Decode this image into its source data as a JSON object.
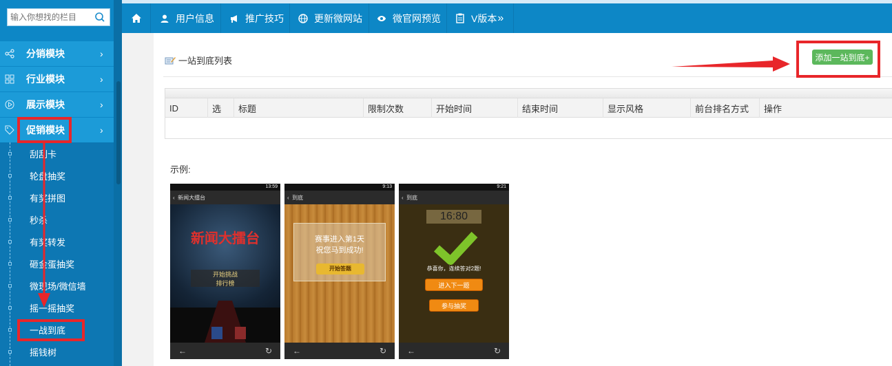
{
  "sidebar": {
    "search_placeholder": "输入你想找的栏目",
    "groups": [
      {
        "label": "分销模块",
        "icon": "share-icon"
      },
      {
        "label": "行业模块",
        "icon": "grid-icon"
      },
      {
        "label": "展示模块",
        "icon": "play-circle-icon"
      },
      {
        "label": "促销模块",
        "icon": "tag-icon"
      }
    ],
    "sub_items": [
      "刮刮卡",
      "轮盘抽奖",
      "有奖拼图",
      "秒杀",
      "有奖转发",
      "砸金蛋抽奖",
      "微现场/微信墙",
      "摇一摇抽奖",
      "一战到底",
      "摇钱树"
    ],
    "active_sub": "一战到底"
  },
  "topnav": {
    "items": [
      {
        "label": "",
        "icon": "home-icon"
      },
      {
        "label": "用户信息",
        "icon": "user-icon"
      },
      {
        "label": "推广技巧",
        "icon": "megaphone-icon"
      },
      {
        "label": "更新微网站",
        "icon": "globe-icon"
      },
      {
        "label": "微官网预览",
        "icon": "eye-icon"
      },
      {
        "label": "V版本",
        "icon": "clipboard-icon",
        "suffix": "»"
      }
    ]
  },
  "page": {
    "title": "一站到底列表",
    "add_button": "添加一站到底+",
    "table_headers": [
      "ID",
      "选",
      "标题",
      "限制次数",
      "开始时间",
      "结束时间",
      "显示风格",
      "前台排名方式",
      "操作"
    ],
    "example_label": "示例:"
  },
  "phones": [
    {
      "appbar": "新闻大擂台",
      "status_time": "13:59",
      "banner": "新闻大擂台",
      "buttons": [
        "开始挑战",
        "排行榜"
      ]
    },
    {
      "appbar": "到底",
      "status_time": "9:13",
      "card_lines": [
        "赛事进入第1天",
        "祝您马到成功!"
      ],
      "button": "开始答题"
    },
    {
      "appbar": "到底",
      "status_time": "9:21",
      "timer": "16:80",
      "message": "恭喜你，连续答对2题!",
      "buttons": [
        "进入下一题",
        "参与抽奖"
      ]
    }
  ],
  "colors": {
    "primary": "#0d87c6",
    "accent_green": "#5cb85c",
    "highlight_red": "#e8262a"
  }
}
